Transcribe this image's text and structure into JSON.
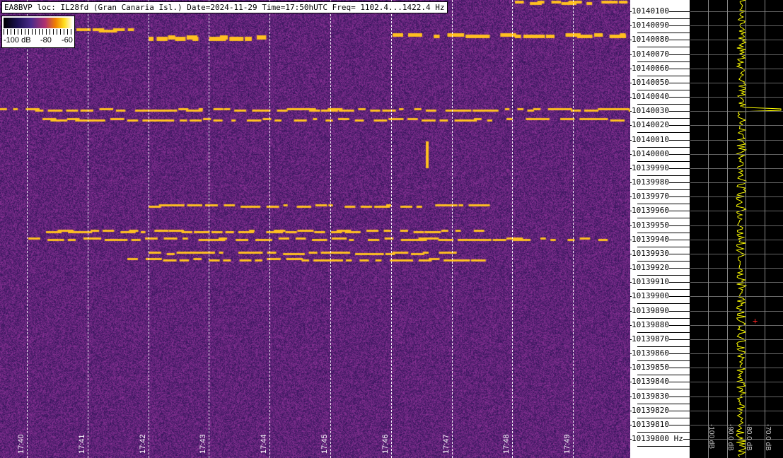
{
  "header": {
    "title": "EA8BVP loc: IL28fd (Gran Canaria Isl.) Date=2024-11-29 Time=17:50hUTC Freq= 1102.4...1422.4 Hz"
  },
  "colorbar": {
    "labels": [
      "-100 dB",
      "-80",
      "-60"
    ]
  },
  "time_axis": {
    "labels": [
      "17:40",
      "17:41",
      "17:42",
      "17:43",
      "17:44",
      "17:45",
      "17:46",
      "17:47",
      "17:48",
      "17:49"
    ]
  },
  "freq_axis": {
    "labels": [
      "10140100",
      "10140090",
      "10140080",
      "10140070",
      "10140060",
      "10140050",
      "10140040",
      "10140030",
      "10140020",
      "10140010",
      "10140000",
      "10139990",
      "10139980",
      "10139970",
      "10139960",
      "10139950",
      "10139940",
      "10139930",
      "10139920",
      "10139910",
      "10139900",
      "10139890",
      "10139880",
      "10139870",
      "10139860",
      "10139850",
      "10139840",
      "10139830",
      "10139820",
      "10139810",
      "10139800 Hz"
    ]
  },
  "spectrum": {
    "db_labels": [
      "-100 dB",
      "-90.0 dB",
      "-80.0 dB",
      "-70.0 dB"
    ]
  },
  "colors": {
    "background": "#2a1458",
    "signal": "#ffc020",
    "trace": "#ffff00"
  }
}
